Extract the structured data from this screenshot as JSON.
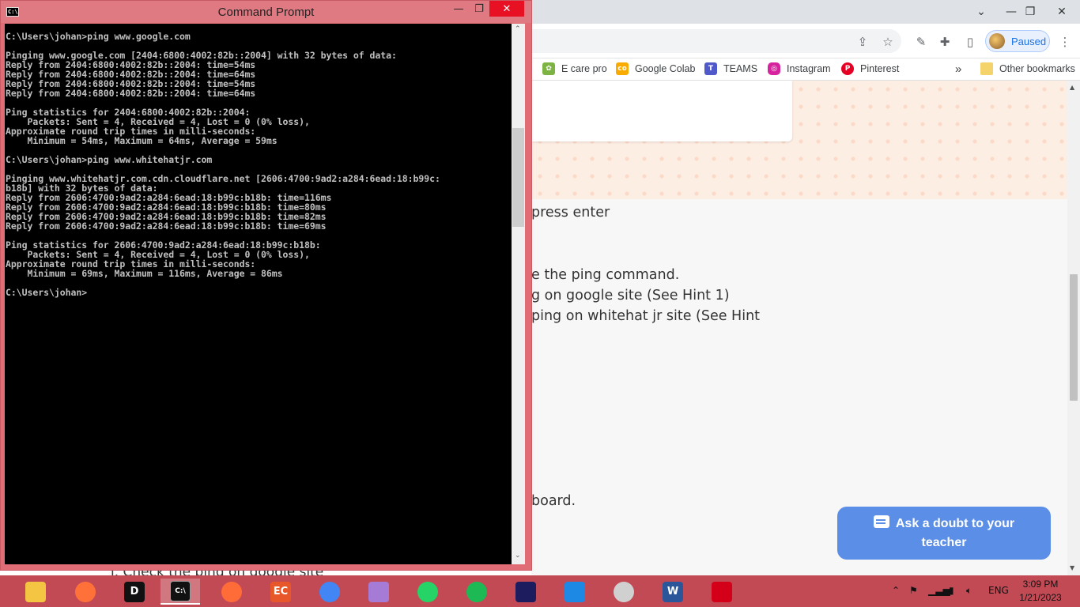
{
  "chrome": {
    "profile_label": "Paused",
    "bookmarks": [
      {
        "label": "E care pro",
        "icon": "leaf-icon",
        "color": "#7cb342"
      },
      {
        "label": "Google Colab",
        "icon": "colab-icon",
        "color": "#f9ab00"
      },
      {
        "label": "TEAMS",
        "icon": "teams-icon",
        "color": "#5059c9"
      },
      {
        "label": "Instagram",
        "icon": "instagram-icon",
        "color": "#d6249f"
      },
      {
        "label": "Pinterest",
        "icon": "pinterest-icon",
        "color": "#e60023"
      }
    ],
    "bookmarks_overflow": "»",
    "other_bookmarks": "Other bookmarks"
  },
  "page": {
    "line1": "press enter",
    "line2": "e the ping command.",
    "line3": "g on google site (See Hint 1)",
    "line4": "ping on whitehat jr site (See Hint",
    "line5": "board.",
    "hidden_line": "i. Check the ping on google site",
    "doubt_button_line1": "Ask a doubt to your",
    "doubt_button_line2": "teacher"
  },
  "cmd": {
    "title": "Command Prompt",
    "lines": [
      "C:\\Users\\johan>ping www.google.com",
      "",
      "Pinging www.google.com [2404:6800:4002:82b::2004] with 32 bytes of data:",
      "Reply from 2404:6800:4002:82b::2004: time=54ms",
      "Reply from 2404:6800:4002:82b::2004: time=64ms",
      "Reply from 2404:6800:4002:82b::2004: time=54ms",
      "Reply from 2404:6800:4002:82b::2004: time=64ms",
      "",
      "Ping statistics for 2404:6800:4002:82b::2004:",
      "    Packets: Sent = 4, Received = 4, Lost = 0 (0% loss),",
      "Approximate round trip times in milli-seconds:",
      "    Minimum = 54ms, Maximum = 64ms, Average = 59ms",
      "",
      "C:\\Users\\johan>ping www.whitehatjr.com",
      "",
      "Pinging www.whitehatjr.com.cdn.cloudflare.net [2606:4700:9ad2:a284:6ead:18:b99c:",
      "b18b] with 32 bytes of data:",
      "Reply from 2606:4700:9ad2:a284:6ead:18:b99c:b18b: time=116ms",
      "Reply from 2606:4700:9ad2:a284:6ead:18:b99c:b18b: time=80ms",
      "Reply from 2606:4700:9ad2:a284:6ead:18:b99c:b18b: time=82ms",
      "Reply from 2606:4700:9ad2:a284:6ead:18:b99c:b18b: time=69ms",
      "",
      "Ping statistics for 2606:4700:9ad2:a284:6ead:18:b99c:b18b:",
      "    Packets: Sent = 4, Received = 4, Lost = 0 (0% loss),",
      "Approximate round trip times in milli-seconds:",
      "    Minimum = 69ms, Maximum = 116ms, Average = 86ms",
      "",
      "C:\\Users\\johan>"
    ]
  },
  "taskbar": {
    "apps": [
      {
        "name": "file-explorer-icon",
        "color": "#f4c542",
        "glyph": ""
      },
      {
        "name": "firefox-icon",
        "color": "#ff7139",
        "glyph": ""
      },
      {
        "name": "d-app-icon",
        "color": "#111111",
        "glyph": "D"
      },
      {
        "name": "command-prompt-icon",
        "color": "#111111",
        "glyph": "C:\\"
      },
      {
        "name": "postman-icon",
        "color": "#ff6c37",
        "glyph": ""
      },
      {
        "name": "ec-app-icon",
        "color": "#e8572a",
        "glyph": "EC"
      },
      {
        "name": "chrome-icon",
        "color": "#4285f4",
        "glyph": ""
      },
      {
        "name": "windows-app-icon",
        "color": "#a67bd6",
        "glyph": ""
      },
      {
        "name": "whatsapp-icon",
        "color": "#25d366",
        "glyph": ""
      },
      {
        "name": "spotify-icon",
        "color": "#1db954",
        "glyph": ""
      },
      {
        "name": "media-app-icon",
        "color": "#1c1c5e",
        "glyph": ""
      },
      {
        "name": "vscode-icon",
        "color": "#1e88e5",
        "glyph": ""
      },
      {
        "name": "onedrive-icon",
        "color": "#d0d0d0",
        "glyph": ""
      },
      {
        "name": "word-icon",
        "color": "#2b579a",
        "glyph": "W"
      },
      {
        "name": "acrobat-icon",
        "color": "#d4001a",
        "glyph": ""
      }
    ],
    "language": "ENG",
    "time": "3:09 PM",
    "date": "1/21/2023"
  }
}
